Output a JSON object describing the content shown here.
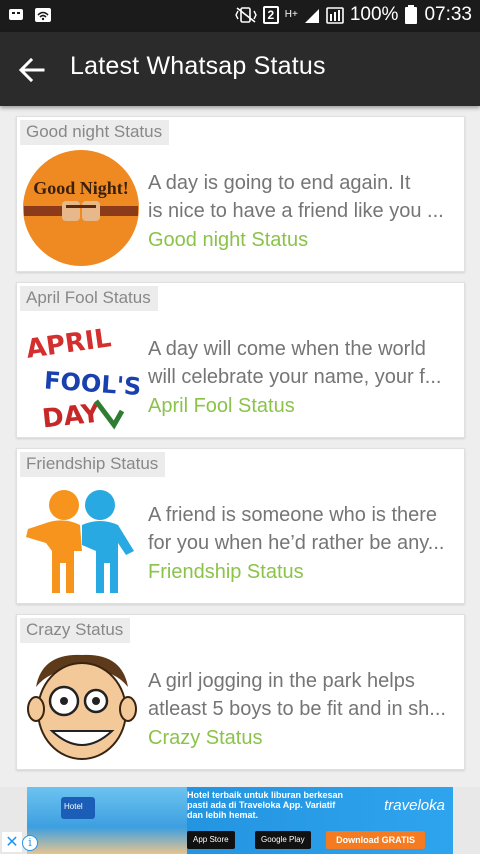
{
  "status_bar": {
    "battery": "100%",
    "time": "07:33",
    "sim": "2",
    "network": "H+"
  },
  "app_bar": {
    "title": "Latest Whatsap Status",
    "back_icon": "arrow-left-icon"
  },
  "items": [
    {
      "label": "Good night Status",
      "excerpt_line1": "A day is going to end again. It",
      "excerpt_line2": "is nice to have a friend like you ...",
      "category": "Good night Status",
      "thumb_text": "Good Night!"
    },
    {
      "label": "April Fool Status",
      "excerpt_line1": "A day will come when the world",
      "excerpt_line2": "will celebrate your name, your f...",
      "category": "April Fool Status",
      "thumb_text_1": "APRIL",
      "thumb_text_2": "FOOL'S",
      "thumb_text_3": "DAY"
    },
    {
      "label": "Friendship Status",
      "excerpt_line1": "A friend is someone who is there",
      "excerpt_line2": "for you when he’d rather be any...",
      "category": "Friendship Status"
    },
    {
      "label": "Crazy Status",
      "excerpt_line1": "A girl jogging in the park helps",
      "excerpt_line2": "atleast 5 boys to be fit and in sh...",
      "category": "Crazy Status"
    }
  ],
  "ad": {
    "hotel_label": "Hotel",
    "headline_1": "Hotel terbaik untuk liburan berkesan",
    "headline_2": "pasti ada di Traveloka App. Variatif",
    "headline_3": "dan lebih hemat.",
    "brand": "traveloka",
    "app_store": "App Store",
    "google_play": "Google Play",
    "download": "Download GRATIS",
    "close_icon": "close-icon",
    "info_icon": "info-icon"
  },
  "colors": {
    "app_bar": "#2b2b2b",
    "status_bar": "#1b1b1b",
    "category_accent": "#8bc34a",
    "background": "#eeeeee"
  }
}
